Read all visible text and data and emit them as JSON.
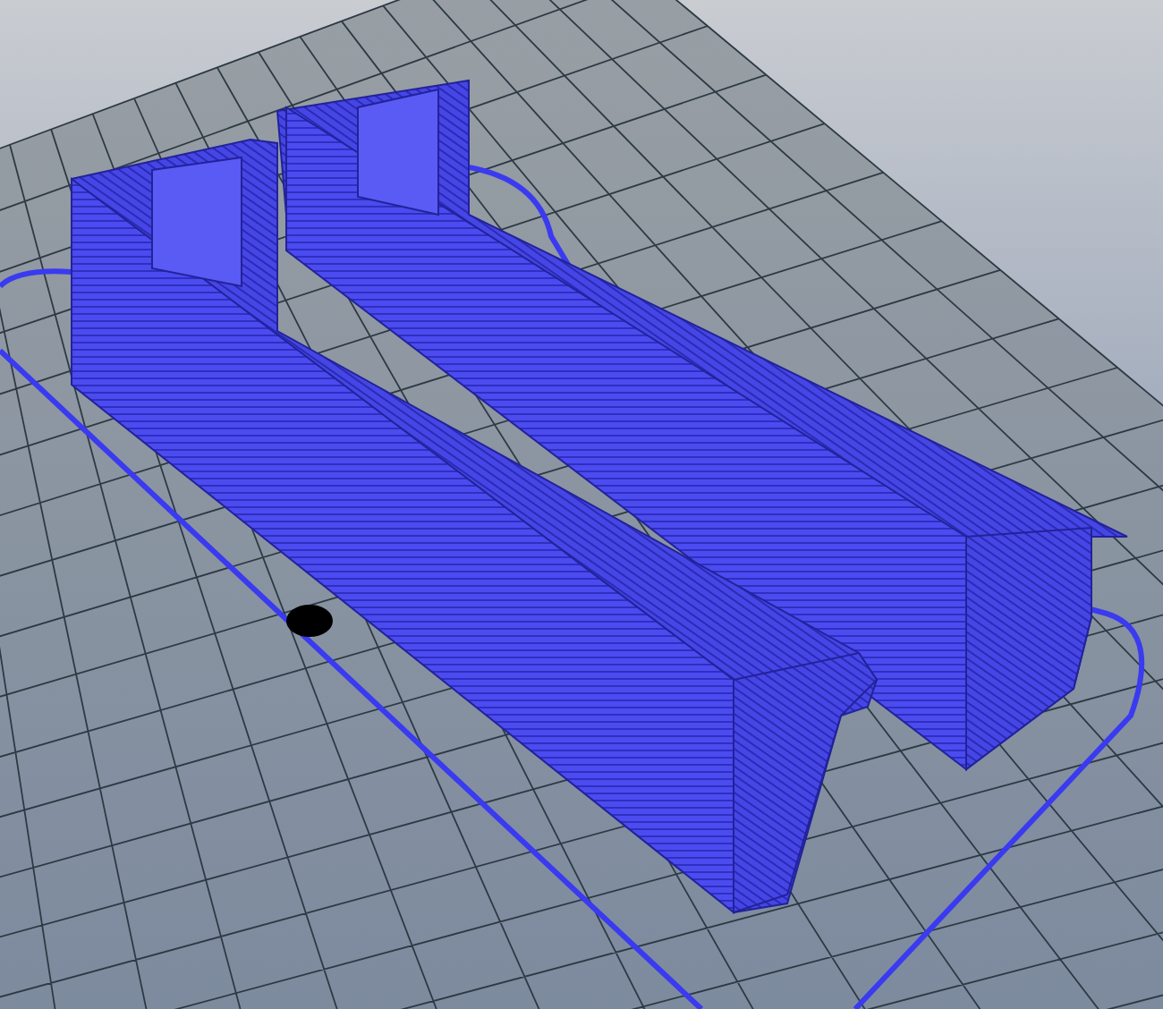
{
  "scene": {
    "kind": "toolpath-preview"
  }
}
